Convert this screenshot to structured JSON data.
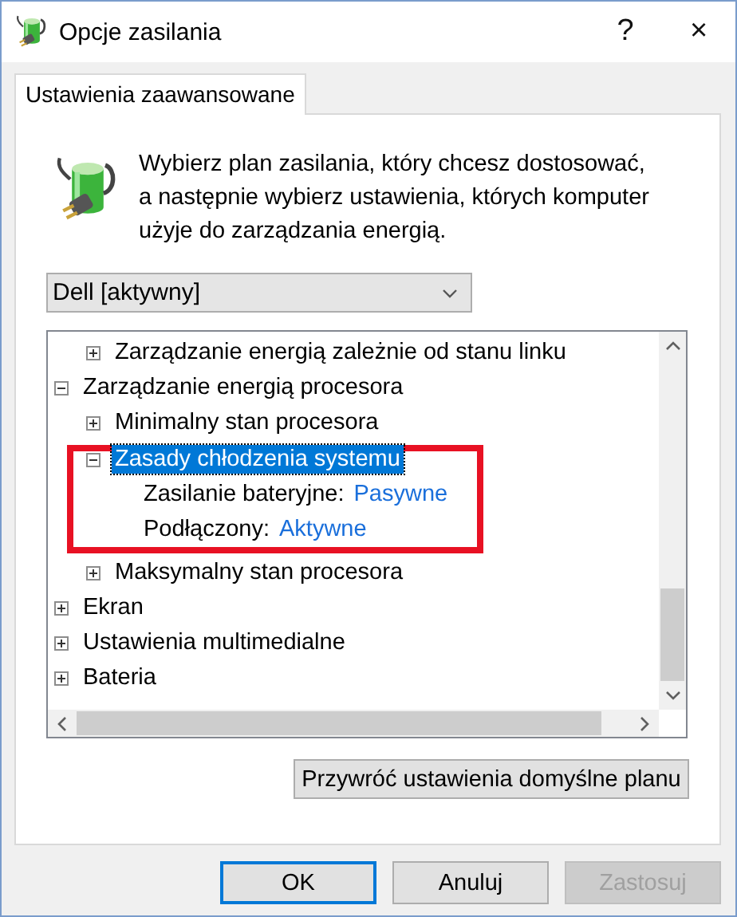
{
  "window": {
    "title": "Opcje zasilania",
    "buttons": [
      "?",
      "×"
    ]
  },
  "tabs": [
    {
      "label": "Ustawienia zaawansowane",
      "selected": true
    }
  ],
  "intro": "Wybierz plan zasilania, który chcesz dostosować, a następnie wybierz ustawienia, których komputer użyje do zarządzania energią.",
  "plan_select": {
    "value": "Dell [aktywny]"
  },
  "tree": [
    {
      "children": [
        {
          "label": "Zarządzanie energią zależnie od stanu linku",
          "expanded": false,
          "selected": false
        }
      ]
    },
    {
      "label": "Zarządzanie energią procesora",
      "expanded": true,
      "selected": false,
      "children": [
        {
          "label": "Minimalny stan procesora",
          "expanded": false,
          "selected": false
        },
        {
          "label": "Zasady chłodzenia systemu",
          "expanded": true,
          "selected": true,
          "highlighted": true,
          "children": [
            {
              "kind": "setting",
              "label": "Zasilanie bateryjne:",
              "value": "Pasywne"
            },
            {
              "kind": "setting",
              "label": "Podłączony:",
              "value": "Aktywne"
            }
          ]
        },
        {
          "label": "Maksymalny stan procesora",
          "expanded": false,
          "selected": false
        }
      ]
    },
    {
      "label": "Ekran",
      "expanded": false,
      "selected": false
    },
    {
      "label": "Ustawienia multimedialne",
      "expanded": false,
      "selected": false
    },
    {
      "label": "Bateria",
      "expanded": false,
      "selected": false
    }
  ],
  "restore_button": "Przywróć ustawienia domyślne planu",
  "buttons": [
    {
      "label": "OK",
      "default": true,
      "disabled": false
    },
    {
      "label": "Anuluj",
      "default": false,
      "disabled": false
    },
    {
      "label": "Zastosuj",
      "default": false,
      "disabled": true
    }
  ]
}
